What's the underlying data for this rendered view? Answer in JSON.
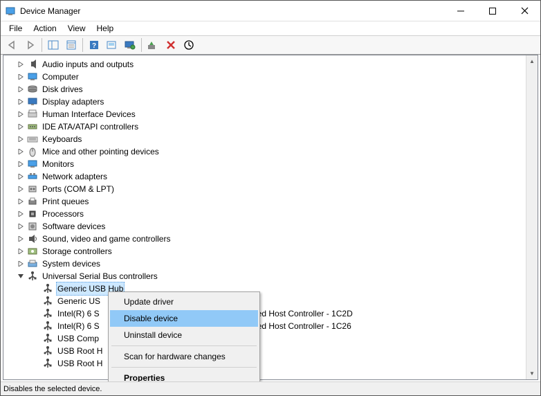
{
  "window": {
    "title": "Device Manager"
  },
  "menubar": {
    "file": "File",
    "action": "Action",
    "view": "View",
    "help": "Help"
  },
  "tree": {
    "items": [
      {
        "label": "Audio inputs and outputs",
        "icon": "audio"
      },
      {
        "label": "Computer",
        "icon": "computer"
      },
      {
        "label": "Disk drives",
        "icon": "disk"
      },
      {
        "label": "Display adapters",
        "icon": "display"
      },
      {
        "label": "Human Interface Devices",
        "icon": "hid"
      },
      {
        "label": "IDE ATA/ATAPI controllers",
        "icon": "ide"
      },
      {
        "label": "Keyboards",
        "icon": "keyboard"
      },
      {
        "label": "Mice and other pointing devices",
        "icon": "mouse"
      },
      {
        "label": "Monitors",
        "icon": "monitor"
      },
      {
        "label": "Network adapters",
        "icon": "network"
      },
      {
        "label": "Ports (COM & LPT)",
        "icon": "ports"
      },
      {
        "label": "Print queues",
        "icon": "printer"
      },
      {
        "label": "Processors",
        "icon": "cpu"
      },
      {
        "label": "Software devices",
        "icon": "software"
      },
      {
        "label": "Sound, video and game controllers",
        "icon": "sound"
      },
      {
        "label": "Storage controllers",
        "icon": "storage"
      },
      {
        "label": "System devices",
        "icon": "system"
      }
    ],
    "usb_category": "Universal Serial Bus controllers",
    "usb_children": [
      "Generic USB Hub",
      "Generic US",
      "Intel(R) 6 S",
      "Intel(R) 6 S",
      "USB Comp",
      "USB Root H",
      "USB Root H"
    ],
    "usb_suffix_2": "ced Host Controller - 1C2D",
    "usb_suffix_3": "ced Host Controller - 1C26"
  },
  "context_menu": {
    "update": "Update driver",
    "disable": "Disable device",
    "uninstall": "Uninstall device",
    "scan": "Scan for hardware changes",
    "properties": "Properties"
  },
  "statusbar": {
    "text": "Disables the selected device."
  }
}
